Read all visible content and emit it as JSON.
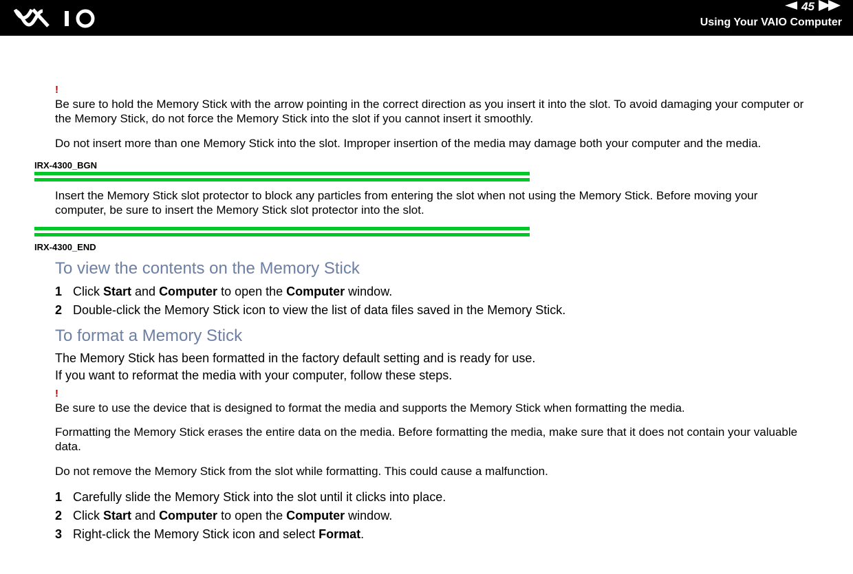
{
  "header": {
    "page_number": "45",
    "section": "Using Your VAIO Computer"
  },
  "warning1": {
    "bang": "!",
    "p1": "Be sure to hold the Memory Stick with the arrow pointing in the correct direction as you insert it into the slot. To avoid damaging your computer or the Memory Stick, do not force the Memory Stick into the slot if you cannot insert it smoothly.",
    "p2": "Do not insert more than one Memory Stick into the slot. Improper insertion of the media may damage both your computer and the media."
  },
  "marker_bgn": "IRX-4300_BGN",
  "protector_note": "Insert the Memory Stick slot protector to block any particles from entering the slot when not using the Memory Stick. Before moving your computer, be sure to insert the Memory Stick slot protector into the slot.",
  "marker_end": "IRX-4300_END",
  "view": {
    "heading": "To view the contents on the Memory Stick",
    "step1": {
      "a": "Click ",
      "b1": "Start",
      "b": " and ",
      "b2": "Computer",
      "c": " to open the ",
      "b3": "Computer",
      "d": " window."
    },
    "step2": "Double-click the Memory Stick icon to view the list of data files saved in the Memory Stick."
  },
  "format": {
    "heading": "To format a Memory Stick",
    "intro1": "The Memory Stick has been formatted in the factory default setting and is ready for use.",
    "intro2": "If you want to reformat the media with your computer, follow these steps.",
    "warn": {
      "bang": "!",
      "p1": "Be sure to use the device that is designed to format the media and supports the Memory Stick when formatting the media.",
      "p2": "Formatting the Memory Stick erases the entire data on the media. Before formatting the media, make sure that it does not contain your valuable data.",
      "p3": "Do not remove the Memory Stick from the slot while formatting. This could cause a malfunction."
    },
    "step1": "Carefully slide the Memory Stick into the slot until it clicks into place.",
    "step2": {
      "a": "Click ",
      "b1": "Start",
      "b": " and ",
      "b2": "Computer",
      "c": " to open the ",
      "b3": "Computer",
      "d": " window."
    },
    "step3": {
      "a": "Right-click the Memory Stick icon and select ",
      "b1": "Format",
      "b": "."
    }
  }
}
